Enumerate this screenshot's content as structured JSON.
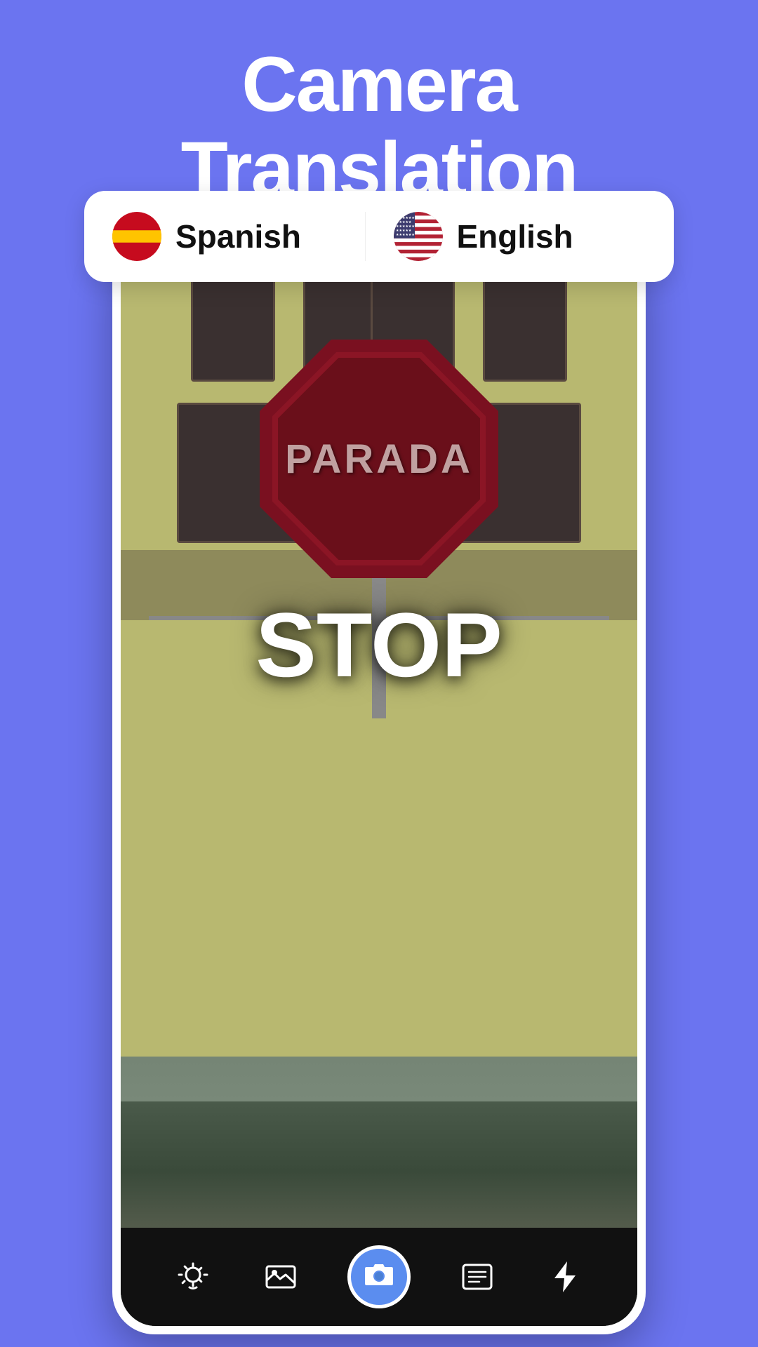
{
  "header": {
    "title_line1": "Camera",
    "title_line2": "Translation"
  },
  "language_selector": {
    "source": {
      "name": "Spanish",
      "flag": "🇪🇸"
    },
    "target": {
      "name": "English",
      "flag": "🇺🇸"
    }
  },
  "camera_view": {
    "sign_text": "PARADA",
    "translation_text": "STOP"
  },
  "toolbar": {
    "icons": [
      "settings-icon",
      "gallery-icon",
      "shutter-icon",
      "text-icon",
      "flash-icon"
    ]
  }
}
